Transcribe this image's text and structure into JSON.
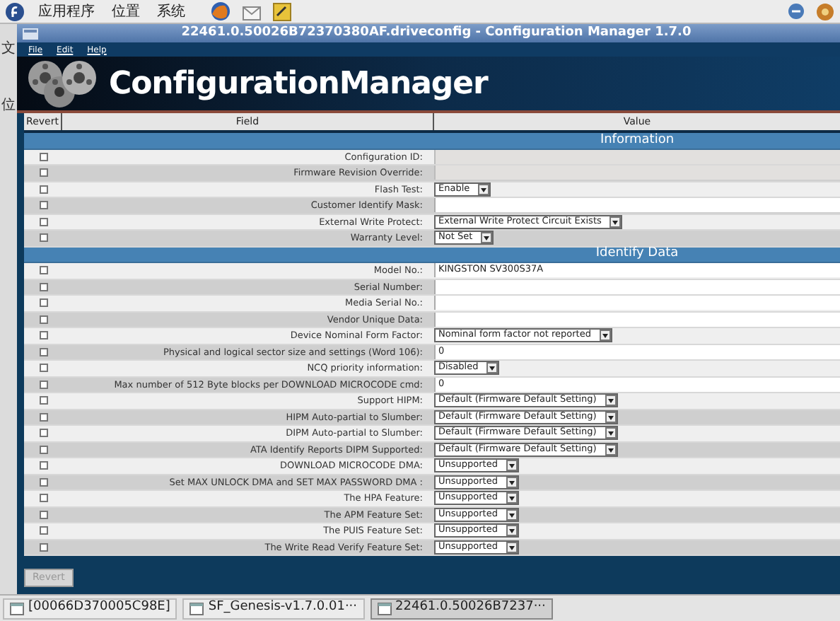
{
  "top_panel": {
    "menus": [
      "应用程序",
      "位置",
      "系统"
    ]
  },
  "background_window": {
    "texts": [
      "文",
      "位"
    ]
  },
  "window": {
    "title": "22461.0.50026B72370380AF.driveconfig - Configuration Manager 1.7.0",
    "menus": [
      "File",
      "Edit",
      "Help"
    ],
    "banner_title": "ConfigurationManager"
  },
  "table": {
    "columns": [
      "Revert",
      "Field",
      "Value"
    ],
    "sections": [
      {
        "title": "Information",
        "rows": [
          {
            "field": "Configuration ID:",
            "checked": false,
            "kind": "readonly"
          },
          {
            "field": "Firmware Revision Override:",
            "checked": false,
            "kind": "readonly"
          },
          {
            "field": "Flash Test:",
            "checked": false,
            "kind": "select",
            "value": "Enable"
          },
          {
            "field": "Customer Identify Mask:",
            "checked": false,
            "kind": "text"
          },
          {
            "field": "External Write Protect:",
            "checked": false,
            "kind": "select",
            "value": "External Write Protect Circuit Exists"
          },
          {
            "field": "Warranty Level:",
            "checked": false,
            "kind": "select",
            "value": "Not Set"
          }
        ]
      },
      {
        "title": "Identify Data",
        "rows": [
          {
            "field": "Model No.:",
            "checked": false,
            "kind": "text",
            "value": "KINGSTON SV300S37A"
          },
          {
            "field": "Serial Number:",
            "checked": false,
            "kind": "text"
          },
          {
            "field": "Media Serial No.:",
            "checked": false,
            "kind": "text"
          },
          {
            "field": "Vendor Unique Data:",
            "checked": false,
            "kind": "text"
          },
          {
            "field": "Device Nominal Form Factor:",
            "checked": false,
            "kind": "select",
            "value": "Nominal form factor not reported"
          },
          {
            "field": "Physical and logical sector size and settings (Word 106):",
            "checked": false,
            "kind": "text",
            "value": "0"
          },
          {
            "field": "NCQ priority information:",
            "checked": false,
            "kind": "select",
            "value": "Disabled"
          },
          {
            "field": "Max number of 512 Byte blocks per DOWNLOAD MICROCODE cmd:",
            "checked": false,
            "kind": "text",
            "value": "0"
          },
          {
            "field": "Support HIPM:",
            "checked": false,
            "kind": "select",
            "value": "Default (Firmware Default Setting)"
          },
          {
            "field": "HIPM Auto-partial to Slumber:",
            "checked": false,
            "kind": "select",
            "value": "Default (Firmware Default Setting)"
          },
          {
            "field": "DIPM Auto-partial to Slumber:",
            "checked": false,
            "kind": "select",
            "value": "Default (Firmware Default Setting)"
          },
          {
            "field": "ATA Identify Reports DIPM Supported:",
            "checked": false,
            "kind": "select",
            "value": "Default (Firmware Default Setting)"
          },
          {
            "field": "DOWNLOAD MICROCODE DMA:",
            "checked": false,
            "kind": "select",
            "value": "Unsupported"
          },
          {
            "field": "Set MAX UNLOCK DMA and SET MAX PASSWORD DMA :",
            "checked": false,
            "kind": "select",
            "value": "Unsupported"
          },
          {
            "field": "The HPA Feature:",
            "checked": false,
            "kind": "select",
            "value": "Unsupported"
          },
          {
            "field": "The APM Feature Set:",
            "checked": false,
            "kind": "select",
            "value": "Unsupported"
          },
          {
            "field": "The PUIS Feature Set:",
            "checked": false,
            "kind": "select",
            "value": "Unsupported"
          },
          {
            "field": "The Write Read Verify Feature Set:",
            "checked": false,
            "kind": "select",
            "value": "Unsupported"
          }
        ]
      }
    ]
  },
  "revert_button": {
    "label": "Revert",
    "disabled": true
  },
  "taskbar": [
    {
      "label": "[00066D370005C98E]",
      "selected": false
    },
    {
      "label": "SF_Genesis-v1.7.0.01···",
      "selected": false
    },
    {
      "label": "22461.0.50026B7237···",
      "selected": true
    }
  ]
}
